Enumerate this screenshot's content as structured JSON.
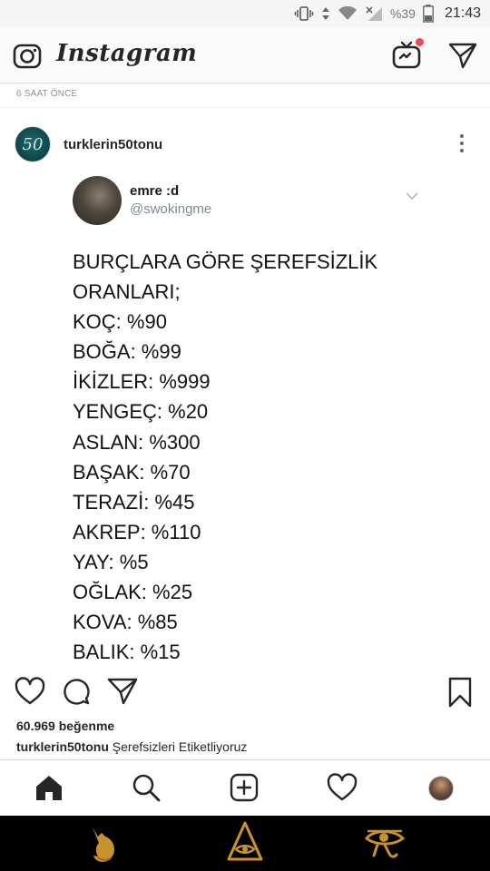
{
  "status_bar": {
    "battery": "%39",
    "time": "21:43"
  },
  "header": {
    "brand": "Instagram",
    "icons": {
      "camera": "camera-icon",
      "igtv": "igtv-icon",
      "direct": "direct-message-icon"
    },
    "notification_color": "#ed4956"
  },
  "feed": {
    "time_ago": "6 SAAT ÖNCE"
  },
  "post": {
    "avatar_text": "50",
    "username": "turklerin50tonu",
    "tweet": {
      "name": "emre :d",
      "handle": "@swokingme",
      "lines": [
        "BURÇLARA GÖRE ŞEREFSİZLİK",
        "ORANLARI;",
        "KOÇ: %90",
        "BOĞA: %99",
        "İKİZLER: %999",
        "YENGEÇ: %20",
        "ASLAN: %300",
        "BAŞAK: %70",
        "TERAZİ: %45",
        "AKREP: %110",
        "YAY: %5",
        "OĞLAK: %25",
        "KOVA: %85",
        "BALIK: %15"
      ]
    },
    "likes": "60.969 beğenme",
    "caption": {
      "username": "turklerin50tonu",
      "text": "Şerefsizleri Etiketliyoruz"
    }
  },
  "bottom_nav": {
    "items": [
      "home-icon",
      "search-icon",
      "new-post-icon",
      "activity-icon",
      "profile-avatar"
    ]
  },
  "system_nav": {
    "items": [
      "back-anubis-icon",
      "home-pyramid-icon",
      "recents-eye-icon"
    ],
    "color": "#c8922e"
  }
}
